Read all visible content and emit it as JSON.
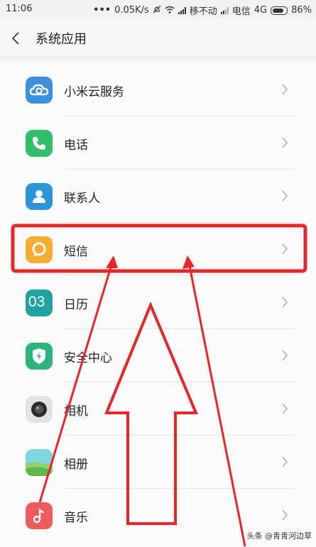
{
  "status_bar": {
    "time": "11:06",
    "speed": "0.05K/s",
    "carrier1": "移不动",
    "carrier2": "电信",
    "network": "4G",
    "battery": "86%"
  },
  "header": {
    "title": "系统应用"
  },
  "apps": [
    {
      "label": "小米云服务",
      "icon": "mi-cloud-icon",
      "color": "#3d8fe0"
    },
    {
      "label": "电话",
      "icon": "phone-icon",
      "color": "#2fbf6a"
    },
    {
      "label": "联系人",
      "icon": "contacts-icon",
      "color": "#2a95d8"
    },
    {
      "label": "短信",
      "icon": "message-icon",
      "color": "#f6ac33"
    },
    {
      "label": "日历",
      "icon": "calendar-icon",
      "color": "#1fa3a0"
    },
    {
      "label": "安全中心",
      "icon": "security-shield-icon",
      "color": "#2ab57a"
    },
    {
      "label": "相机",
      "icon": "camera-icon",
      "color": "#e3e3e3"
    },
    {
      "label": "相册",
      "icon": "gallery-icon",
      "color": "#6ed4c8"
    },
    {
      "label": "音乐",
      "icon": "music-icon",
      "color": "#ef5a5f"
    }
  ],
  "calendar_icon_text": "03",
  "annotation_color": "#e8262a",
  "watermark": "头条 @青青河边草"
}
